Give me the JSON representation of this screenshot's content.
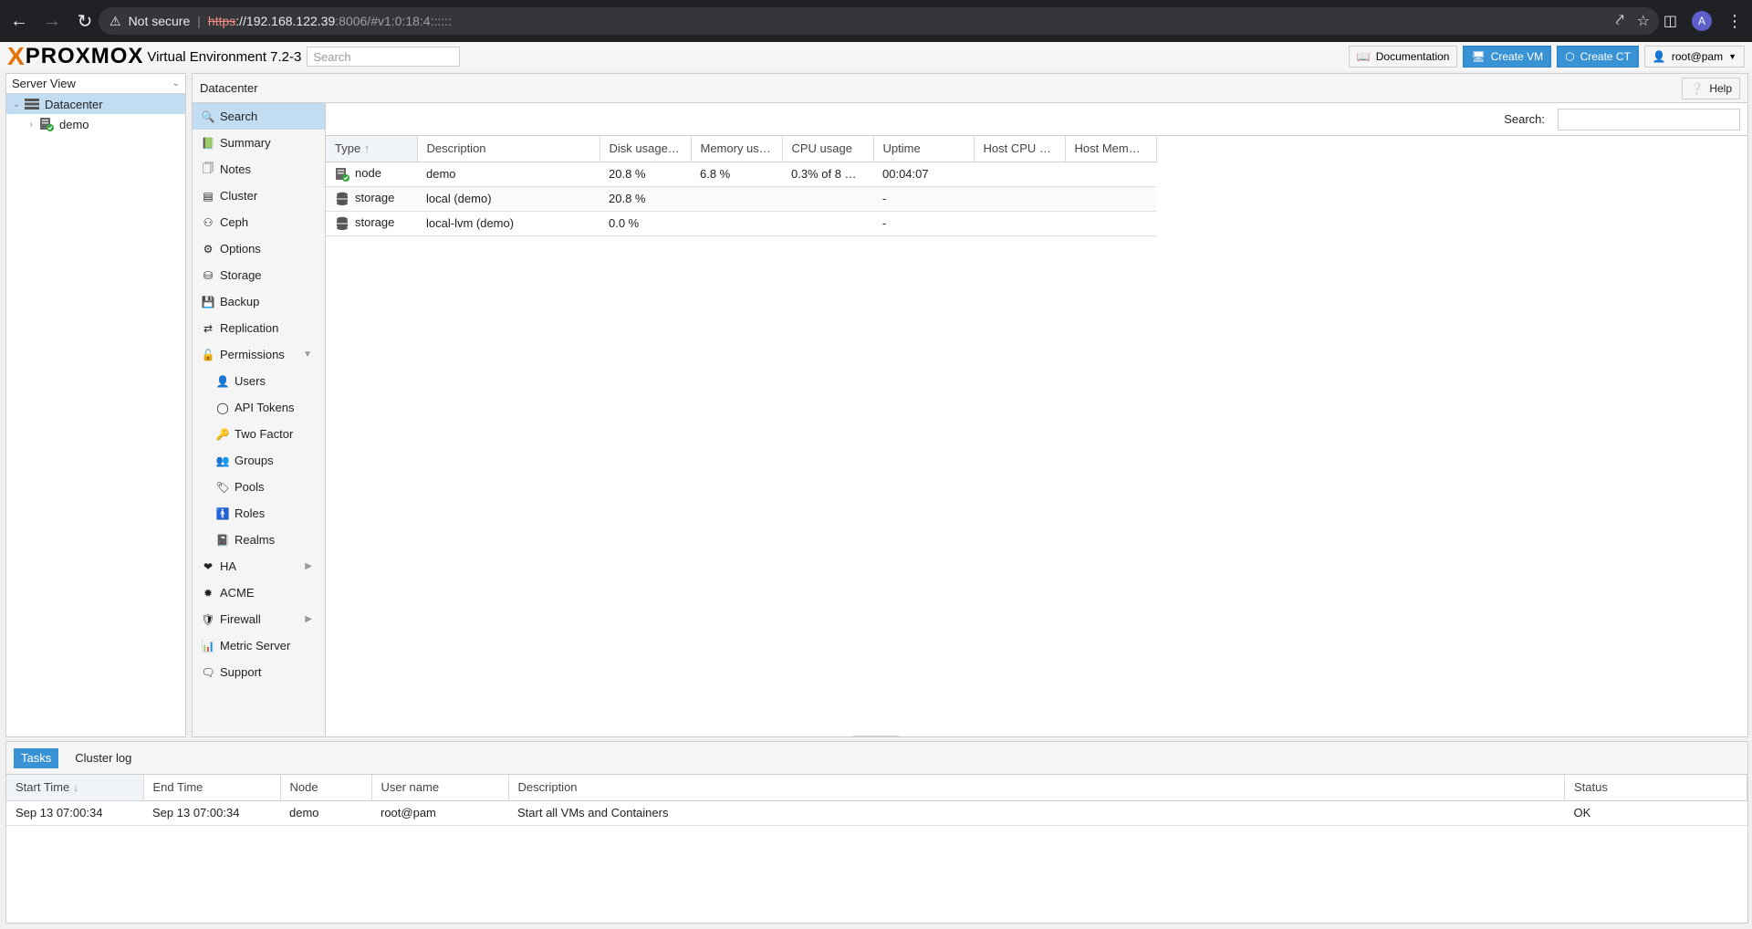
{
  "browser": {
    "security_label": "Not secure",
    "url_scheme": "https",
    "url_host": "://192.168.122.39",
    "url_rest": ":8006/#v1:0:18:4::::::",
    "avatar_letter": "A"
  },
  "header": {
    "logo_x": "X",
    "logo_text": "PROXMOX",
    "product": "Virtual Environment 7.2-3",
    "search_placeholder": "Search",
    "buttons": {
      "documentation": "Documentation",
      "create_vm": "Create VM",
      "create_ct": "Create CT",
      "user": "root@pam"
    }
  },
  "tree": {
    "view": "Server View",
    "items": [
      {
        "label": "Datacenter"
      },
      {
        "label": "demo"
      }
    ]
  },
  "content": {
    "title": "Datacenter",
    "help": "Help",
    "search_label": "Search:"
  },
  "menu": {
    "items": [
      {
        "label": "Search"
      },
      {
        "label": "Summary"
      },
      {
        "label": "Notes"
      },
      {
        "label": "Cluster"
      },
      {
        "label": "Ceph"
      },
      {
        "label": "Options"
      },
      {
        "label": "Storage"
      },
      {
        "label": "Backup"
      },
      {
        "label": "Replication"
      },
      {
        "label": "Permissions"
      },
      {
        "label": "Users"
      },
      {
        "label": "API Tokens"
      },
      {
        "label": "Two Factor"
      },
      {
        "label": "Groups"
      },
      {
        "label": "Pools"
      },
      {
        "label": "Roles"
      },
      {
        "label": "Realms"
      },
      {
        "label": "HA"
      },
      {
        "label": "ACME"
      },
      {
        "label": "Firewall"
      },
      {
        "label": "Metric Server"
      },
      {
        "label": "Support"
      }
    ]
  },
  "resources": {
    "columns": [
      "Type",
      "Description",
      "Disk usage…",
      "Memory us…",
      "CPU usage",
      "Uptime",
      "Host CPU …",
      "Host Mem…"
    ],
    "rows": [
      {
        "type": "node",
        "desc": "demo",
        "disk": "20.8 %",
        "mem": "6.8 %",
        "cpu": "0.3% of 8 …",
        "uptime": "00:04:07",
        "hcpu": "",
        "hmem": ""
      },
      {
        "type": "storage",
        "desc": "local (demo)",
        "disk": "20.8 %",
        "mem": "",
        "cpu": "",
        "uptime": "-",
        "hcpu": "",
        "hmem": ""
      },
      {
        "type": "storage",
        "desc": "local-lvm (demo)",
        "disk": "0.0 %",
        "mem": "",
        "cpu": "",
        "uptime": "-",
        "hcpu": "",
        "hmem": ""
      }
    ]
  },
  "bottom": {
    "tabs": [
      "Tasks",
      "Cluster log"
    ],
    "columns": [
      "Start Time",
      "End Time",
      "Node",
      "User name",
      "Description",
      "Status"
    ],
    "rows": [
      {
        "start": "Sep 13 07:00:34",
        "end": "Sep 13 07:00:34",
        "node": "demo",
        "user": "root@pam",
        "desc": "Start all VMs and Containers",
        "status": "OK"
      }
    ]
  },
  "colors": {
    "accent": "#3892d4",
    "selection": "#c2ddf2",
    "logo_orange": "#e57000",
    "status_ok": "#2fa83a"
  }
}
